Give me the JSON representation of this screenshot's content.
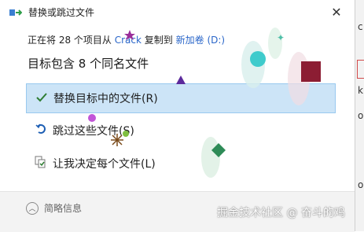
{
  "window": {
    "title": "替换或跳过文件",
    "close_symbol": "✕"
  },
  "status": {
    "prefix": "正在将 28 个项目从",
    "source": "Crack",
    "middle": "复制到",
    "destination": "新加卷 (D:)"
  },
  "heading": "目标包含 8 个同名文件",
  "options": [
    {
      "label": "替换目标中的文件(R)",
      "icon": "checkmark-icon"
    },
    {
      "label": "跳过这些文件(S)",
      "icon": "skip-icon"
    },
    {
      "label": "让我决定每个文件(L)",
      "icon": "decide-files-icon"
    }
  ],
  "footer": {
    "details_label": "简略信息",
    "watermark": "掘金技术社区 @ 奋斗的鸡"
  },
  "colors": {
    "accent": "#2a66c9",
    "selected_bg": "#cce4f7",
    "check": "#2e7d32"
  },
  "background_app": {
    "fragments": [
      "c",
      "k",
      "ol",
      "ol"
    ]
  }
}
